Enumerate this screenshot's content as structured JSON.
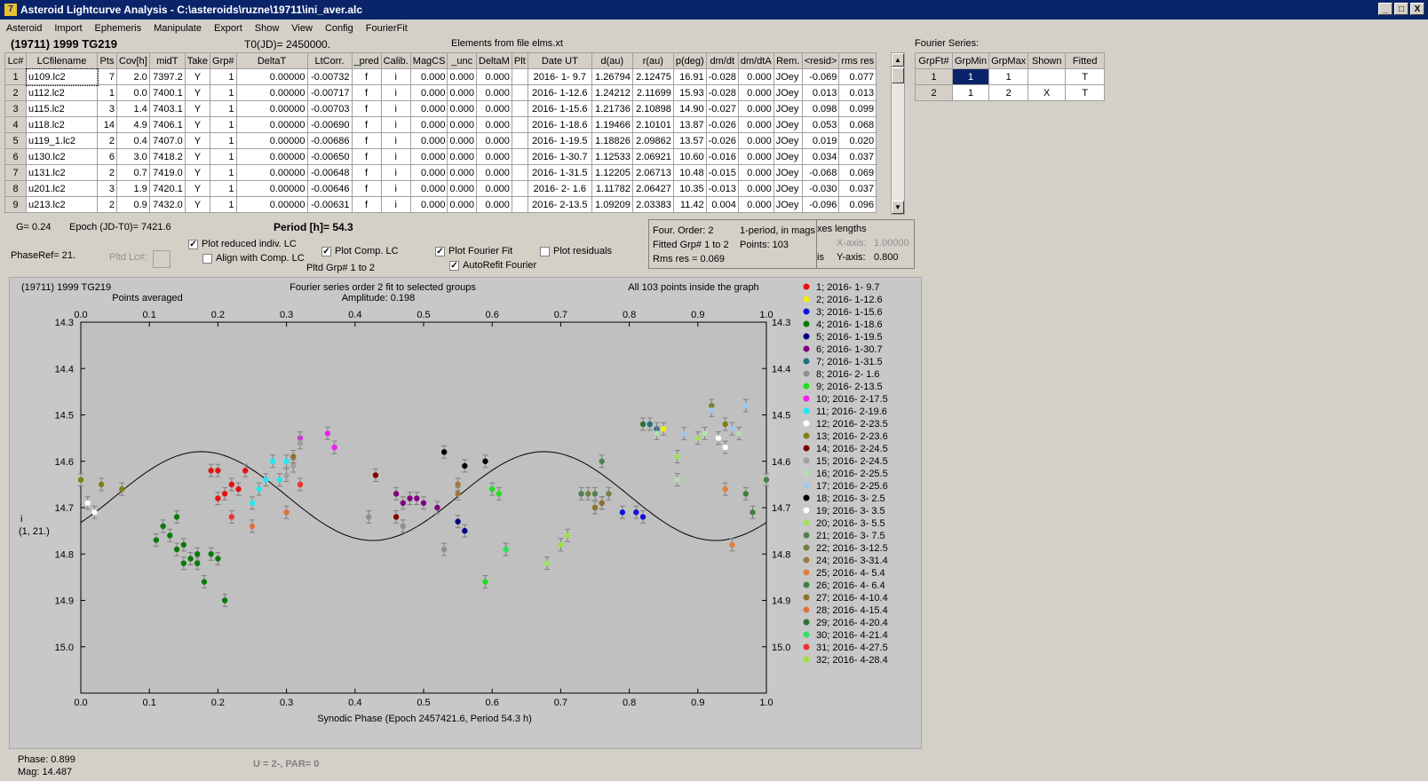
{
  "window": {
    "title": "Asteroid Lightcurve Analysis - C:\\asteroids\\ruzne\\19711\\ini_aver.alc",
    "icon_label": "7"
  },
  "window_buttons": [
    "_",
    "□",
    "X"
  ],
  "menu": [
    "Asteroid",
    "Import",
    "Ephemeris",
    "Manipulate",
    "Export",
    "Show",
    "View",
    "Config",
    "FourierFit"
  ],
  "header": {
    "asteroid": "(19711) 1999 TG219",
    "t0": "T0(JD)= 2450000.",
    "elements": "Elements from file elms.xt"
  },
  "lc_table": {
    "columns": [
      "Lc#",
      "LCfilename",
      "Pts",
      "Cov[h]",
      "midT",
      "Take",
      "Grp#",
      "DeltaT",
      "LtCorr.",
      "_pred",
      "Calib.",
      "MagCS",
      "_unc",
      "DeltaM",
      "Plt",
      "Date UT",
      "d(au)",
      "r(au)",
      "p(deg)",
      "dm/dt",
      "dm/dtA",
      "Rem.",
      "<resid>",
      "rms res"
    ],
    "rows": [
      [
        "1",
        "u109.lc2",
        "7",
        "2.0",
        "7397.2",
        "Y",
        "1",
        "0.00000",
        "-0.00732",
        "f",
        "i",
        "0.000",
        "0.000",
        "0.000",
        "",
        "2016- 1- 9.7",
        "1.26794",
        "2.12475",
        "16.91",
        "-0.028",
        "0.000",
        "JOey",
        "-0.069",
        "0.077"
      ],
      [
        "2",
        "u112.lc2",
        "1",
        "0.0",
        "7400.1",
        "Y",
        "1",
        "0.00000",
        "-0.00717",
        "f",
        "i",
        "0.000",
        "0.000",
        "0.000",
        "",
        "2016- 1-12.6",
        "1.24212",
        "2.11699",
        "15.93",
        "-0.028",
        "0.000",
        "JOey",
        "0.013",
        "0.013"
      ],
      [
        "3",
        "u115.lc2",
        "3",
        "1.4",
        "7403.1",
        "Y",
        "1",
        "0.00000",
        "-0.00703",
        "f",
        "i",
        "0.000",
        "0.000",
        "0.000",
        "",
        "2016- 1-15.6",
        "1.21736",
        "2.10898",
        "14.90",
        "-0.027",
        "0.000",
        "JOey",
        "0.098",
        "0.099"
      ],
      [
        "4",
        "u118.lc2",
        "14",
        "4.9",
        "7406.1",
        "Y",
        "1",
        "0.00000",
        "-0.00690",
        "f",
        "i",
        "0.000",
        "0.000",
        "0.000",
        "",
        "2016- 1-18.6",
        "1.19466",
        "2.10101",
        "13.87",
        "-0.026",
        "0.000",
        "JOey",
        "0.053",
        "0.068"
      ],
      [
        "5",
        "u119_1.lc2",
        "2",
        "0.4",
        "7407.0",
        "Y",
        "1",
        "0.00000",
        "-0.00686",
        "f",
        "i",
        "0.000",
        "0.000",
        "0.000",
        "",
        "2016- 1-19.5",
        "1.18826",
        "2.09862",
        "13.57",
        "-0.026",
        "0.000",
        "JOey",
        "0.019",
        "0.020"
      ],
      [
        "6",
        "u130.lc2",
        "6",
        "3.0",
        "7418.2",
        "Y",
        "1",
        "0.00000",
        "-0.00650",
        "f",
        "i",
        "0.000",
        "0.000",
        "0.000",
        "",
        "2016- 1-30.7",
        "1.12533",
        "2.06921",
        "10.60",
        "-0.016",
        "0.000",
        "JOey",
        "0.034",
        "0.037"
      ],
      [
        "7",
        "u131.lc2",
        "2",
        "0.7",
        "7419.0",
        "Y",
        "1",
        "0.00000",
        "-0.00648",
        "f",
        "i",
        "0.000",
        "0.000",
        "0.000",
        "",
        "2016- 1-31.5",
        "1.12205",
        "2.06713",
        "10.48",
        "-0.015",
        "0.000",
        "JOey",
        "-0.068",
        "0.069"
      ],
      [
        "8",
        "u201.lc2",
        "3",
        "1.9",
        "7420.1",
        "Y",
        "1",
        "0.00000",
        "-0.00646",
        "f",
        "i",
        "0.000",
        "0.000",
        "0.000",
        "",
        "2016- 2- 1.6",
        "1.11782",
        "2.06427",
        "10.35",
        "-0.013",
        "0.000",
        "JOey",
        "-0.030",
        "0.037"
      ],
      [
        "9",
        "u213.lc2",
        "2",
        "0.9",
        "7432.0",
        "Y",
        "1",
        "0.00000",
        "-0.00631",
        "f",
        "i",
        "0.000",
        "0.000",
        "0.000",
        "",
        "2016- 2-13.5",
        "1.09209",
        "2.03383",
        "11.42",
        "0.004",
        "0.000",
        "JOey",
        "-0.096",
        "0.096"
      ]
    ]
  },
  "fourier": {
    "title": "Fourier Series:",
    "columns": [
      "GrpFt#",
      "GrpMin",
      "GrpMax",
      "Shown",
      "Fitted"
    ],
    "rows": [
      [
        "1",
        "1",
        "1",
        "",
        "T"
      ],
      [
        "2",
        "1",
        "2",
        "X",
        "T"
      ]
    ]
  },
  "controls": {
    "g": "G= 0.24",
    "epoch": "Epoch (JD-T0)= 7421.6",
    "period": "Period [h]= 54.3",
    "phaseref": "PhaseRef= 21.",
    "pltd_lc": "Pltd Lc#:",
    "plot_reduced": "Plot reduced indiv. LC",
    "align_comp": "Align with Comp. LC",
    "plot_comp": "Plot Comp. LC",
    "pltd_grp": "Pltd Grp#  1  to  2",
    "plot_fourier": "Plot Fourier Fit",
    "autorefit": "AutoRefit Fourier",
    "plot_residuals": "Plot residuals",
    "check": "✓"
  },
  "fit_info": {
    "order": "Four. Order:  2",
    "period_mode": "1-period, in mags",
    "fitted": "Fitted Grp# 1 to 2",
    "points": "Points: 103",
    "rms": "Rms res     = 0.069"
  },
  "axes_box": {
    "title": "xes lengths",
    "xaxis_label": "X-axis:",
    "xaxis_val": "1.00000",
    "is": "is",
    "yaxis_label": "Y-axis:",
    "yaxis_val": "0.800"
  },
  "status": {
    "phase": "Phase:  0.899",
    "mag": "Mag:     14.487",
    "upar": "U = 2-, PAR= 0"
  },
  "chart_data": {
    "type": "scatter",
    "title": "Fourier series order 2 fit to selected groups",
    "subtitle": "Amplitude: 0.198",
    "top_left": "(19711) 1999 TG219",
    "top_left2": "Points averaged",
    "top_right": "All 103 points inside the graph",
    "xlabel": "Synodic Phase (Epoch 2457421.6, Period 54.3 h)",
    "ylabel": "i",
    "ylabel2": "(1, 21.)",
    "xlim": [
      0.0,
      1.0
    ],
    "ylim": [
      14.3,
      15.1
    ],
    "y_inverted": true,
    "x_ticks": [
      "0.0",
      "0.1",
      "0.2",
      "0.3",
      "0.4",
      "0.5",
      "0.6",
      "0.7",
      "0.8",
      "0.9",
      "1.0"
    ],
    "y_ticks": [
      "14.3",
      "14.4",
      "14.5",
      "14.6",
      "14.7",
      "14.8",
      "14.9",
      "15.0"
    ],
    "fourier_fit": {
      "mean": 14.675,
      "a1": 0.0,
      "b1": 0.0,
      "a2": 0.057,
      "b2": -0.077
    },
    "series": [
      {
        "name": "1; 2016- 1- 9.7",
        "color": "#e81010",
        "points": [
          [
            0.19,
            14.62
          ],
          [
            0.2,
            14.62
          ],
          [
            0.2,
            14.68
          ],
          [
            0.21,
            14.67
          ],
          [
            0.22,
            14.65
          ],
          [
            0.23,
            14.66
          ],
          [
            0.24,
            14.62
          ]
        ]
      },
      {
        "name": "2; 2016- 1-12.6",
        "color": "#f0f000",
        "points": [
          [
            0.85,
            14.53
          ]
        ]
      },
      {
        "name": "3; 2016- 1-15.6",
        "color": "#1010e0",
        "points": [
          [
            0.81,
            14.71
          ],
          [
            0.82,
            14.72
          ],
          [
            0.79,
            14.71
          ]
        ]
      },
      {
        "name": "4; 2016- 1-18.6",
        "color": "#0a7a0a",
        "points": [
          [
            0.11,
            14.77
          ],
          [
            0.12,
            14.74
          ],
          [
            0.13,
            14.76
          ],
          [
            0.14,
            14.79
          ],
          [
            0.14,
            14.72
          ],
          [
            0.15,
            14.78
          ],
          [
            0.15,
            14.82
          ],
          [
            0.16,
            14.81
          ],
          [
            0.17,
            14.82
          ],
          [
            0.17,
            14.8
          ],
          [
            0.18,
            14.86
          ],
          [
            0.19,
            14.8
          ],
          [
            0.2,
            14.81
          ],
          [
            0.21,
            14.9
          ]
        ]
      },
      {
        "name": "5; 2016- 1-19.5",
        "color": "#000080",
        "points": [
          [
            0.55,
            14.73
          ],
          [
            0.56,
            14.75
          ]
        ]
      },
      {
        "name": "6; 2016- 1-30.7",
        "color": "#800080",
        "points": [
          [
            0.46,
            14.67
          ],
          [
            0.47,
            14.69
          ],
          [
            0.48,
            14.68
          ],
          [
            0.49,
            14.68
          ],
          [
            0.5,
            14.69
          ],
          [
            0.52,
            14.7
          ]
        ]
      },
      {
        "name": "7; 2016- 1-31.5",
        "color": "#207080",
        "points": [
          [
            0.83,
            14.52
          ],
          [
            0.84,
            14.53
          ]
        ]
      },
      {
        "name": "8; 2016- 2- 1.6",
        "color": "#909090",
        "points": [
          [
            0.42,
            14.72
          ],
          [
            0.47,
            14.74
          ],
          [
            0.53,
            14.79
          ]
        ]
      },
      {
        "name": "9; 2016- 2-13.5",
        "color": "#20e020",
        "points": [
          [
            0.6,
            14.66
          ],
          [
            0.61,
            14.67
          ],
          [
            0.62,
            14.79
          ],
          [
            0.59,
            14.86
          ]
        ]
      },
      {
        "name": "10; 2016- 2-17.5",
        "color": "#f020f0",
        "points": [
          [
            0.32,
            14.55
          ],
          [
            0.36,
            14.54
          ],
          [
            0.37,
            14.57
          ]
        ]
      },
      {
        "name": "11; 2016- 2-19.6",
        "color": "#20e8f0",
        "points": [
          [
            0.26,
            14.66
          ],
          [
            0.27,
            14.64
          ],
          [
            0.28,
            14.6
          ],
          [
            0.29,
            14.64
          ],
          [
            0.3,
            14.6
          ],
          [
            0.25,
            14.69
          ]
        ]
      },
      {
        "name": "12; 2016- 2-23.5",
        "color": "#ffffff",
        "points": [
          [
            0.01,
            14.69
          ],
          [
            0.02,
            14.71
          ],
          [
            0.94,
            14.57
          ]
        ]
      },
      {
        "name": "13; 2016- 2-23.6",
        "color": "#808010",
        "points": [
          [
            0.0,
            14.64
          ],
          [
            0.03,
            14.65
          ],
          [
            0.06,
            14.66
          ],
          [
            0.92,
            14.48
          ],
          [
            0.94,
            14.52
          ]
        ]
      },
      {
        "name": "14; 2016- 2-24.5",
        "color": "#800000",
        "points": [
          [
            0.43,
            14.63
          ],
          [
            0.46,
            14.72
          ]
        ]
      },
      {
        "name": "15; 2016- 2-24.5",
        "color": "#a0a0a0",
        "points": [
          [
            0.31,
            14.61
          ],
          [
            0.32,
            14.56
          ],
          [
            0.3,
            14.63
          ]
        ]
      },
      {
        "name": "16; 2016- 2-25.5",
        "color": "#b0e0b0",
        "points": [
          [
            0.84,
            14.54
          ],
          [
            0.87,
            14.64
          ],
          [
            0.91,
            14.54
          ],
          [
            0.96,
            14.54
          ]
        ]
      },
      {
        "name": "17; 2016- 2-25.6",
        "color": "#a0c8f0",
        "points": [
          [
            0.88,
            14.54
          ],
          [
            0.92,
            14.49
          ],
          [
            0.95,
            14.53
          ],
          [
            0.97,
            14.48
          ]
        ]
      },
      {
        "name": "18; 2016- 3- 2.5",
        "color": "#000000",
        "points": [
          [
            0.53,
            14.58
          ],
          [
            0.56,
            14.61
          ],
          [
            0.59,
            14.6
          ]
        ]
      },
      {
        "name": "19; 2016- 3- 3.5",
        "color": "#ffffff",
        "points": [
          [
            0.93,
            14.55
          ]
        ]
      },
      {
        "name": "20; 2016- 3- 5.5",
        "color": "#a0e060",
        "points": [
          [
            0.87,
            14.59
          ],
          [
            0.9,
            14.55
          ],
          [
            0.68,
            14.82
          ]
        ]
      },
      {
        "name": "21; 2016- 3- 7.5",
        "color": "#508050",
        "points": [
          [
            0.73,
            14.67
          ],
          [
            0.75,
            14.67
          ],
          [
            0.76,
            14.6
          ]
        ]
      },
      {
        "name": "22; 2016- 3-12.5",
        "color": "#708040",
        "points": [
          [
            0.77,
            14.67
          ],
          [
            0.74,
            14.67
          ]
        ]
      },
      {
        "name": "24; 2016- 3-31.4",
        "color": "#a07840",
        "points": [
          [
            0.55,
            14.65
          ],
          [
            0.55,
            14.67
          ],
          [
            0.76,
            14.69
          ],
          [
            0.75,
            14.7
          ]
        ]
      },
      {
        "name": "25; 2016- 4- 5.4",
        "color": "#e08040",
        "points": [
          [
            0.94,
            14.66
          ],
          [
            0.95,
            14.78
          ]
        ]
      },
      {
        "name": "26; 2016- 4- 6.4",
        "color": "#408040",
        "points": [
          [
            0.97,
            14.67
          ],
          [
            0.98,
            14.71
          ],
          [
            1.0,
            14.64
          ]
        ]
      },
      {
        "name": "27; 2016- 4-10.4",
        "color": "#907030",
        "points": [
          [
            0.31,
            14.59
          ],
          [
            0.75,
            14.7
          ],
          [
            0.76,
            14.69
          ]
        ]
      },
      {
        "name": "28; 2016- 4-15.4",
        "color": "#e07040",
        "points": [
          [
            0.25,
            14.74
          ],
          [
            0.3,
            14.71
          ]
        ]
      },
      {
        "name": "29; 2016- 4-20.4",
        "color": "#307030",
        "points": [
          [
            0.82,
            14.52
          ]
        ]
      },
      {
        "name": "30; 2016- 4-21.4",
        "color": "#30e060",
        "points": [
          [
            0.62,
            14.79
          ]
        ]
      },
      {
        "name": "31; 2016- 4-27.5",
        "color": "#f03030",
        "points": [
          [
            0.32,
            14.65
          ],
          [
            0.22,
            14.72
          ]
        ]
      },
      {
        "name": "32; 2016- 4-28.4",
        "color": "#a0e040",
        "points": [
          [
            0.7,
            14.78
          ],
          [
            0.71,
            14.76
          ]
        ]
      }
    ]
  }
}
